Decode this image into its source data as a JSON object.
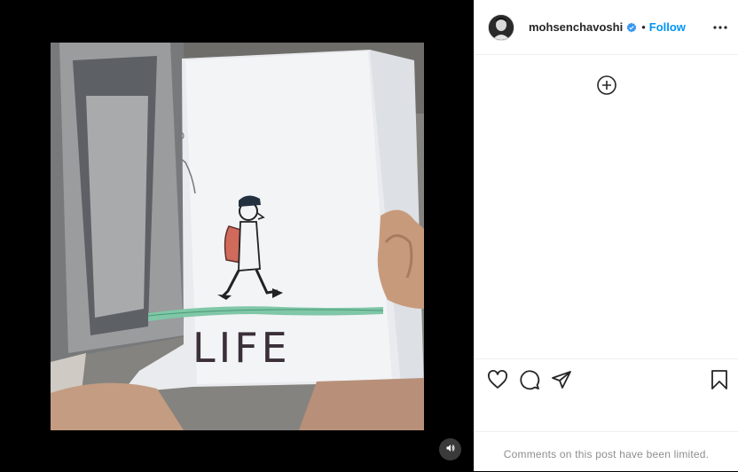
{
  "post": {
    "username": "mohsenchavoshi",
    "separator": "•",
    "follow_label": "Follow",
    "verified": true,
    "comments_limited_text": "Comments on this post have been limited."
  },
  "media": {
    "caption_drawing_text": "LIFE",
    "audio_icon": "volume-icon"
  },
  "icons": {
    "more": "more-options-icon",
    "load_comments": "plus-circle-icon",
    "like": "heart-icon",
    "comment": "comment-bubble-icon",
    "share": "paper-plane-icon",
    "save": "bookmark-icon"
  },
  "colors": {
    "accent": "#0095f6",
    "verified": "#3897f0",
    "muted_text": "#8e8e8e",
    "border": "#efefef"
  }
}
